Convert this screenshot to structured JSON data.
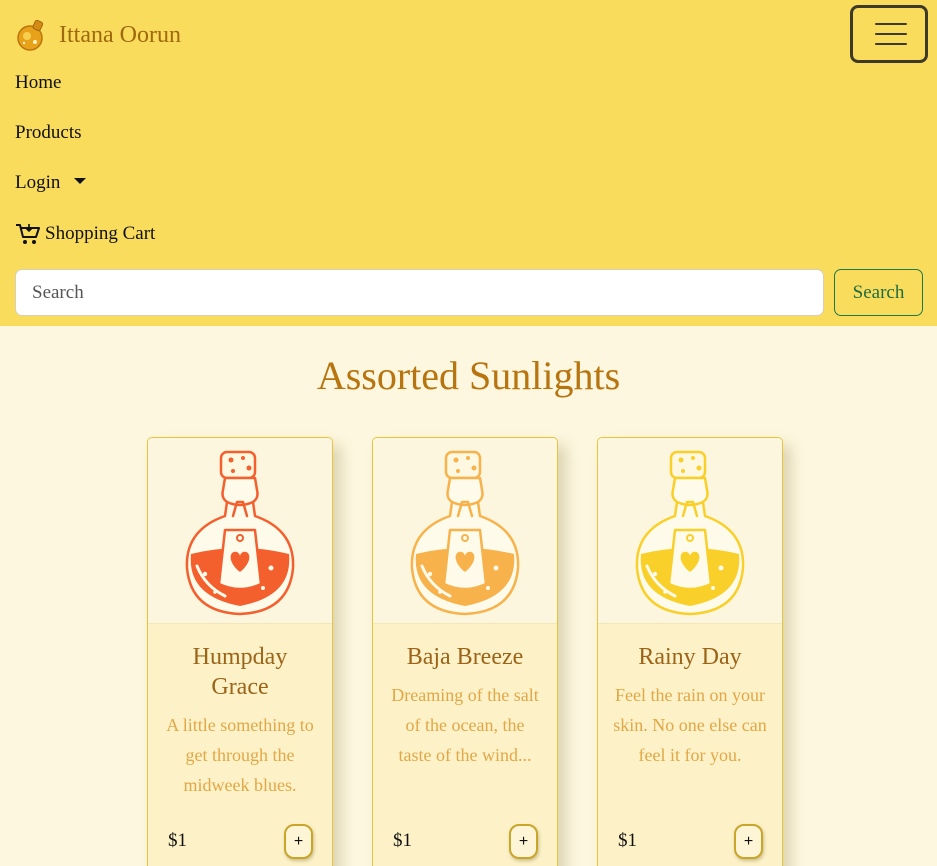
{
  "brand": {
    "name": "Ittana Oorun"
  },
  "nav": {
    "home": "Home",
    "products": "Products",
    "login": "Login",
    "cart": "Shopping Cart"
  },
  "search": {
    "placeholder": "Search",
    "button": "Search"
  },
  "section": {
    "title": "Assorted Sunlights"
  },
  "products": [
    {
      "name": "Humpday Grace",
      "description": "A little something to get through the midweek blues.",
      "price": "$1",
      "add": "+",
      "color": "#f45f2e"
    },
    {
      "name": "Baja Breeze",
      "description": "Dreaming of the salt of the ocean, the taste of the wind...",
      "price": "$1",
      "add": "+",
      "color": "#f8b24c"
    },
    {
      "name": "Rainy Day",
      "description": "Feel the rain on your skin. No one else can feel it for you.",
      "price": "$1",
      "add": "+",
      "color": "#f9d02a"
    }
  ],
  "colors": {
    "navbar": "#f9dc5c",
    "brand": "#a0680f",
    "title": "#b8740f",
    "page_bg": "#fdf7df"
  }
}
